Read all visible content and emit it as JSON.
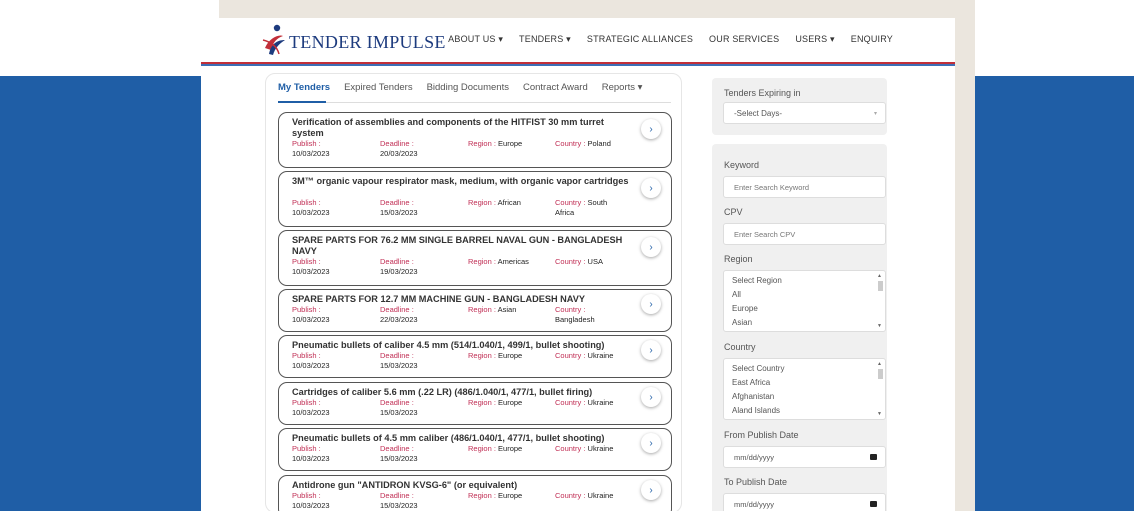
{
  "header": {
    "logo_text": "TENDER IMPULSE",
    "nav": [
      {
        "label": "ABOUT US",
        "dropdown": true
      },
      {
        "label": "TENDERS",
        "dropdown": true
      },
      {
        "label": "STRATEGIC ALLIANCES",
        "dropdown": false
      },
      {
        "label": "OUR SERVICES",
        "dropdown": false
      },
      {
        "label": "USERS",
        "dropdown": true
      },
      {
        "label": "ENQUIRY",
        "dropdown": false
      }
    ]
  },
  "tabs": [
    {
      "label": "My Tenders"
    },
    {
      "label": "Expired Tenders"
    },
    {
      "label": "Bidding Documents"
    },
    {
      "label": "Contract Award"
    },
    {
      "label": "Reports ▾"
    }
  ],
  "labels": {
    "publish": "Publish :",
    "deadline": "Deadline :",
    "region": "Region :",
    "country": "Country :"
  },
  "tenders": [
    {
      "title": "Verification of assemblies and components of the HITFIST 30 mm turret system",
      "publish": "10/03/2023",
      "deadline": "20/03/2023",
      "region": "Europe",
      "country": "Poland"
    },
    {
      "title": "3M™ organic vapour respirator mask, medium, with organic vapor cartridges",
      "publish": "10/03/2023",
      "deadline": "15/03/2023",
      "region": "African",
      "country": "South Africa"
    },
    {
      "title": "SPARE PARTS FOR 76.2 MM SINGLE BARREL NAVAL GUN - BANGLADESH NAVY",
      "publish": "10/03/2023",
      "deadline": "19/03/2023",
      "region": "Americas",
      "country": "USA"
    },
    {
      "title": "SPARE PARTS FOR 12.7 MM MACHINE GUN - BANGLADESH NAVY",
      "publish": "10/03/2023",
      "deadline": "22/03/2023",
      "region": "Asian",
      "country": "Bangladesh"
    },
    {
      "title": "Pneumatic bullets of caliber 4.5 mm (514/1.040/1, 499/1, bullet shooting)",
      "publish": "10/03/2023",
      "deadline": "15/03/2023",
      "region": "Europe",
      "country": "Ukraine"
    },
    {
      "title": "Cartridges of caliber 5.6 mm (.22 LR) (486/1.040/1, 477/1, bullet firing)",
      "publish": "10/03/2023",
      "deadline": "15/03/2023",
      "region": "Europe",
      "country": "Ukraine"
    },
    {
      "title": "Pneumatic bullets of 4.5 mm caliber (486/1.040/1, 477/1, bullet shooting)",
      "publish": "10/03/2023",
      "deadline": "15/03/2023",
      "region": "Europe",
      "country": "Ukraine"
    },
    {
      "title": "Antidrone gun \"ANTIDRON KVSG-6\" (or equivalent)",
      "publish": "10/03/2023",
      "deadline": "15/03/2023",
      "region": "Europe",
      "country": "Ukraine"
    }
  ],
  "filters": {
    "expiring_label": "Tenders Expiring in",
    "expiring_value": "-Select Days-",
    "keyword_label": "Keyword",
    "keyword_placeholder": "Enter Search Keyword",
    "cpv_label": "CPV",
    "cpv_placeholder": "Enter Search CPV",
    "region_label": "Region",
    "region_options": [
      "Select Region",
      "All",
      "Europe",
      "Asian"
    ],
    "country_label": "Country",
    "country_options": [
      "Select Country",
      "East Africa",
      "Afghanistan",
      "Aland Islands"
    ],
    "from_date_label": "From Publish Date",
    "to_date_label": "To Publish Date",
    "date_placeholder": "mm/dd/yyyy"
  },
  "colors": {
    "brand_blue": "#1f5ea6",
    "brand_red": "#c12f39",
    "field_label": "#c12f55"
  }
}
